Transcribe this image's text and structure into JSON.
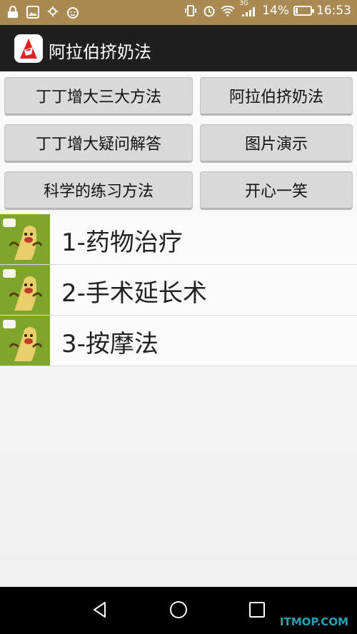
{
  "status_bar": {
    "battery_text": "14%",
    "battery_level": 0.14,
    "time": "16:53",
    "network_label": "3G"
  },
  "app": {
    "title": "阿拉伯挤奶法"
  },
  "menu": {
    "buttons": [
      {
        "label": "丁丁增大三大方法"
      },
      {
        "label": "阿拉伯挤奶法"
      },
      {
        "label": "丁丁增大疑问解答"
      },
      {
        "label": "图片演示"
      },
      {
        "label": "科学的练习方法"
      },
      {
        "label": "开心一笑"
      }
    ]
  },
  "list": {
    "items": [
      {
        "label": "1-药物治疗"
      },
      {
        "label": "2-手术延长术"
      },
      {
        "label": "3-按摩法"
      }
    ]
  },
  "nav": {
    "watermark": "ITMOP.COM"
  },
  "colors": {
    "status_bar": "#a88a52",
    "app_bar": "#1f1f1f",
    "thumb_bg": "#7fa52a",
    "watermark": "#23a3b8"
  }
}
